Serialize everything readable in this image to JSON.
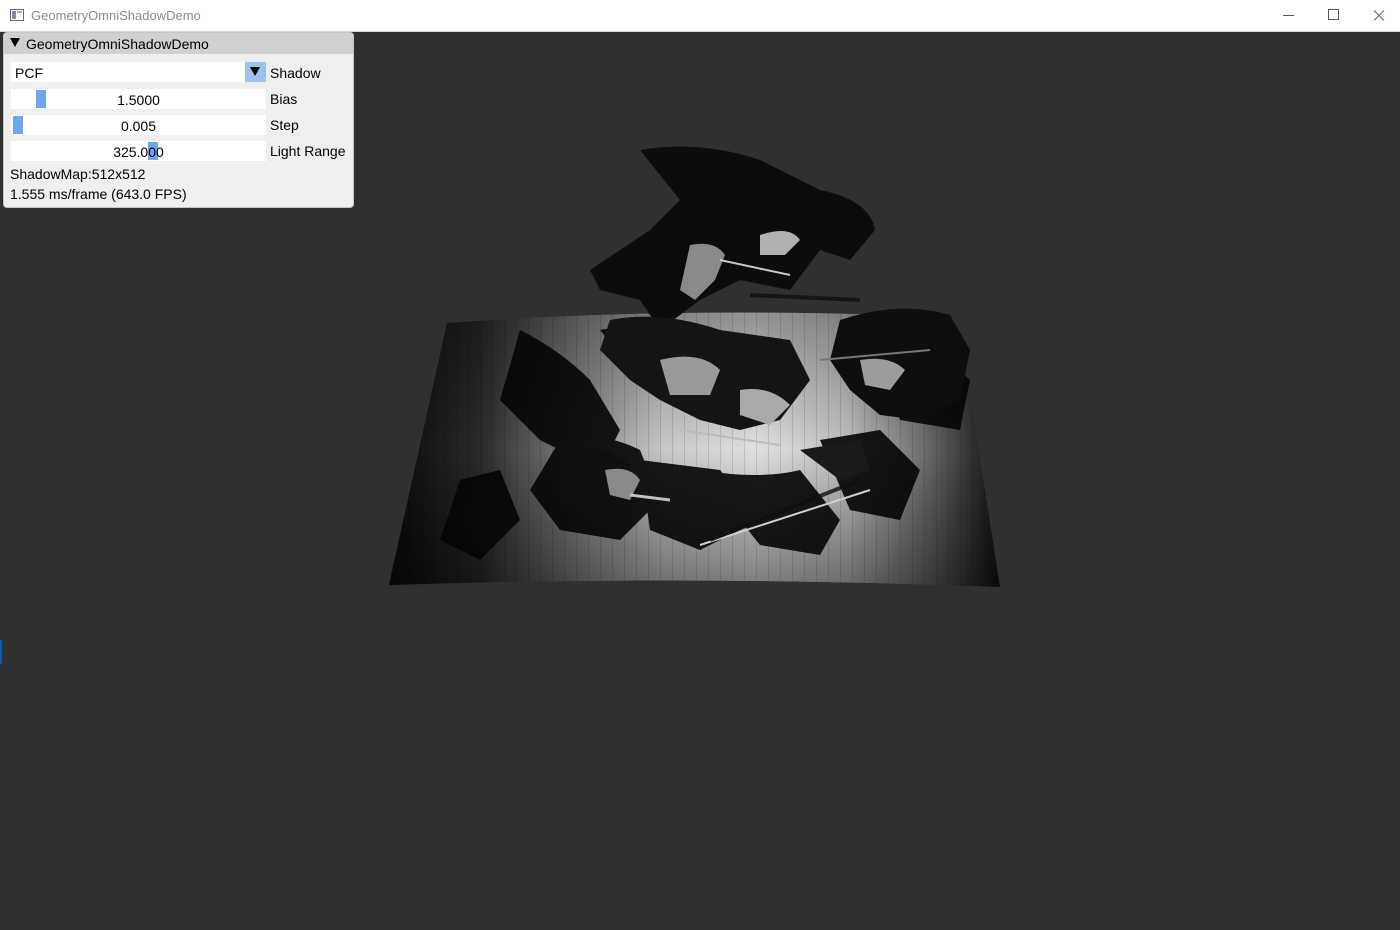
{
  "window": {
    "title": "GeometryOmniShadowDemo"
  },
  "panel": {
    "title": "GeometryOmniShadowDemo",
    "shadow": {
      "label": "Shadow",
      "selected": "PCF"
    },
    "bias": {
      "label": "Bias",
      "value": "1.5000",
      "level_percent": 10
    },
    "step": {
      "label": "Step",
      "value": "0.005",
      "level_percent": 1
    },
    "light_range": {
      "label": "Light Range",
      "value": "325.000",
      "level_percent": 56
    },
    "shadow_map_info": "ShadowMap:512x512",
    "frame_time": "1.555 ms/frame (643.0 FPS)"
  },
  "scene": {
    "background_color": "#303030",
    "panel_accent": "#6ea6ec"
  }
}
